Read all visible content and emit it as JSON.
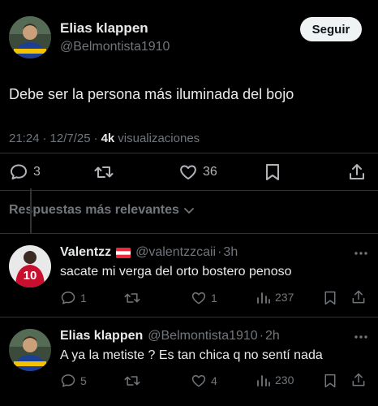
{
  "tweet": {
    "author_name": "Elias klappen",
    "author_handle": "@Belmontista1910",
    "follow_label": "Seguir",
    "text": "Debe ser la persona más iluminada del bojo",
    "time": "21:24",
    "date": "12/7/25",
    "views_count": "4k",
    "views_label": "visualizaciones",
    "sep": "·",
    "replies": "3",
    "likes": "36"
  },
  "replies_header": {
    "label": "Respuestas más relevantes"
  },
  "replies": [
    {
      "name": "Valentzz",
      "handle": "@valentzzcaii",
      "age": "3h",
      "text": "sacate mi verga del orto bostero penoso",
      "replies": "1",
      "likes": "1",
      "views": "237",
      "avatar_number": "10"
    },
    {
      "name": "Elias klappen",
      "handle": "@Belmontista1910",
      "age": "2h",
      "text": "A ya la metiste ? Es tan chica q no sentí nada",
      "replies": "5",
      "likes": "4",
      "views": "230"
    }
  ],
  "colors": {
    "background": "#000000",
    "text": "#e7e9ea",
    "muted": "#71767b",
    "divider": "#2f3336",
    "follow_bg": "#eff3f4",
    "boca_blue": "#1c3f94",
    "boca_yellow": "#f2c200"
  },
  "icons": [
    "reply-icon",
    "retweet-icon",
    "like-icon",
    "views-icon",
    "bookmark-icon",
    "share-icon",
    "chevron-down-icon",
    "flag-icon",
    "more-icon"
  ]
}
